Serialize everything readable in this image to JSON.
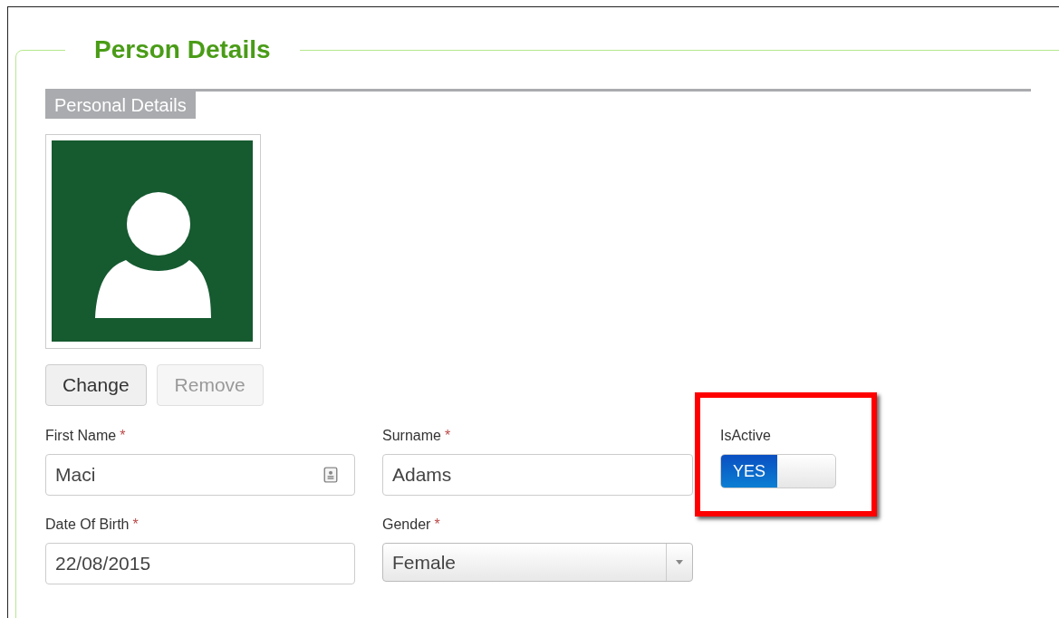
{
  "panel": {
    "title": "Person Details"
  },
  "section": {
    "title": "Personal Details"
  },
  "buttons": [
    {
      "label": "Change",
      "disabled": false
    },
    {
      "label": "Remove",
      "disabled": true
    }
  ],
  "fields": [
    {
      "kind": "text",
      "label": "First Name",
      "required_mark": "*",
      "value": "Maci",
      "contact_icon": true
    },
    {
      "kind": "text",
      "label": "Surname",
      "required_mark": "*",
      "value": "Adams"
    },
    {
      "kind": "toggle",
      "label": "IsActive",
      "on": true,
      "on_text": "YES",
      "highlighted": true
    },
    {
      "kind": "text",
      "label": "Date Of Birth",
      "required_mark": "*",
      "value": "22/08/2015"
    },
    {
      "kind": "select",
      "label": "Gender",
      "required_mark": "*",
      "value": "Female"
    }
  ]
}
